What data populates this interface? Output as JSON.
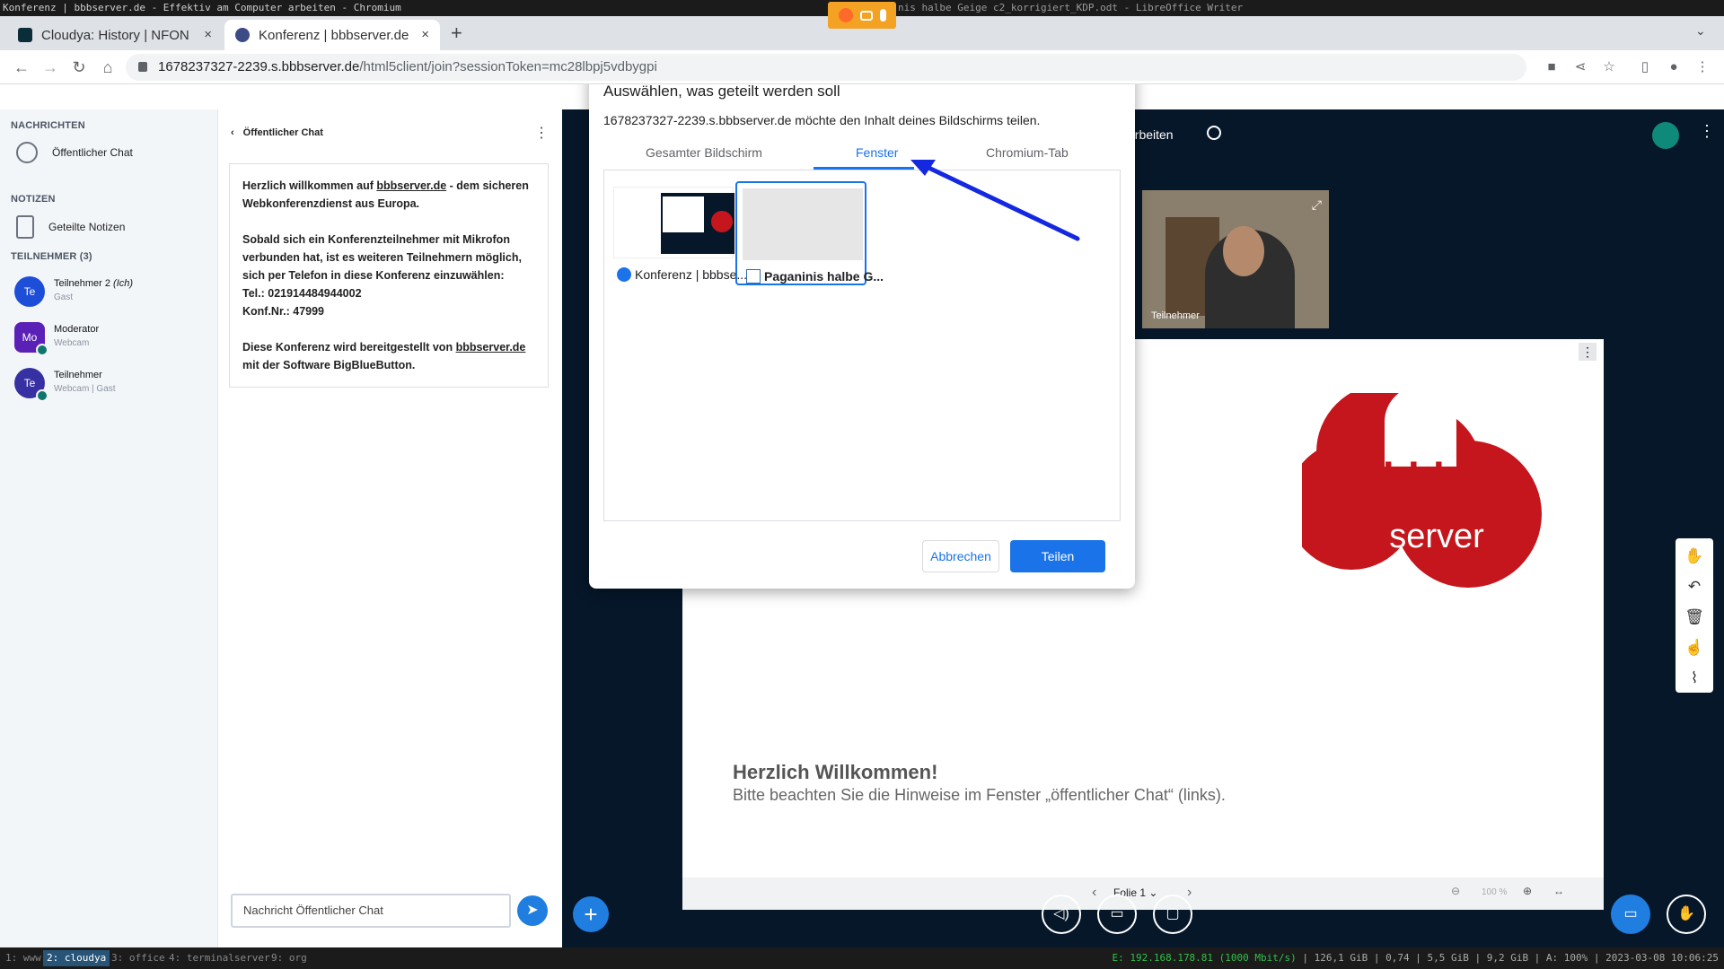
{
  "wm": {
    "title": "Konferenz | bbbserver.de - Effektiv am Computer arbeiten - Chromium",
    "right_title": "nis halbe Geige c2_korrigiert_KDP.odt - LibreOffice Writer"
  },
  "browser": {
    "tabs": [
      {
        "label": "Cloudya: History | NFON",
        "close": "×"
      },
      {
        "label": "Konferenz | bbbserver.de",
        "close": "×"
      }
    ],
    "new_tab": "+",
    "url_host": "1678237327-2239.s.bbbserver.de",
    "url_path": "/html5client/join?sessionToken=mc28lbpj5vdbygpi"
  },
  "sidebar": {
    "messages_heading": "NACHRICHTEN",
    "public_chat": "Öffentlicher Chat",
    "notes_heading": "NOTIZEN",
    "shared_notes": "Geteilte Notizen",
    "participants_heading": "TEILNEHMER (3)",
    "users": [
      {
        "initials": "Te",
        "name": "Teilnehmer 2",
        "me": "(Ich)",
        "sub": "Gast",
        "color": "#1d4ed8"
      },
      {
        "initials": "Mo",
        "name": "Moderator",
        "me": "",
        "sub": "Webcam",
        "color": "#5b21b6"
      },
      {
        "initials": "Te",
        "name": "Teilnehmer",
        "me": "",
        "sub": "Webcam | Gast",
        "color": "#3730a3"
      }
    ]
  },
  "chat": {
    "title": "Öffentlicher Chat",
    "msg1_a": "Herzlich willkommen auf ",
    "msg1_link": "bbbserver.de",
    "msg1_b": " - dem sicheren Webkonferenzdienst aus Europa.",
    "msg2": "Sobald sich ein Konferenzteilnehmer mit Mikrofon verbunden hat, ist es weiteren Teilnehmern möglich, sich per Telefon in diese Konferenz einzuwählen:",
    "tel": "Tel.: 021914484944002",
    "konf": "Konf.Nr.: 47999",
    "msg3_a": "Diese Konferenz wird bereitgestellt von ",
    "msg3_link": "bbbserver.de",
    "msg3_b": " mit der Software BigBlueButton.",
    "input_placeholder": "Nachricht Öffentlicher Chat"
  },
  "main": {
    "header_text": "arbeiten",
    "cam_label": "Teilnehmer",
    "slide": {
      "logo_top": "bbb",
      "logo_bottom": "server",
      "title": "Herzlich Willkommen!",
      "subtitle": "Bitte beachten Sie die Hinweise im Fenster „öffentlicher Chat“ (links).",
      "page_label": "Folie 1",
      "zoom": "100 %"
    }
  },
  "dialog": {
    "title": "Auswählen, was geteilt werden soll",
    "subtitle": "1678237327-2239.s.bbbserver.de möchte den Inhalt deines Bildschirms teilen.",
    "tabs": [
      "Gesamter Bildschirm",
      "Fenster",
      "Chromium-Tab"
    ],
    "windows": [
      "Konferenz | bbbse...",
      "Paganinis halbe G..."
    ],
    "cancel": "Abbrechen",
    "share": "Teilen"
  },
  "statusbar": {
    "workspaces": [
      "1: www",
      "2: cloudya",
      "3: office",
      "4: terminalserver",
      "9: org"
    ],
    "network": "E: 192.168.178.81 (1000 Mbit/s)",
    "stats": "| 126,1 GiB | 0,74 | 5,5 GiB | 9,2 GiB | A: 100% | 2023-03-08 10:06:25"
  },
  "colors": {
    "accent": "#1a73e8",
    "bbb_red": "#c4161c",
    "bbb_bg": "#06172a"
  }
}
